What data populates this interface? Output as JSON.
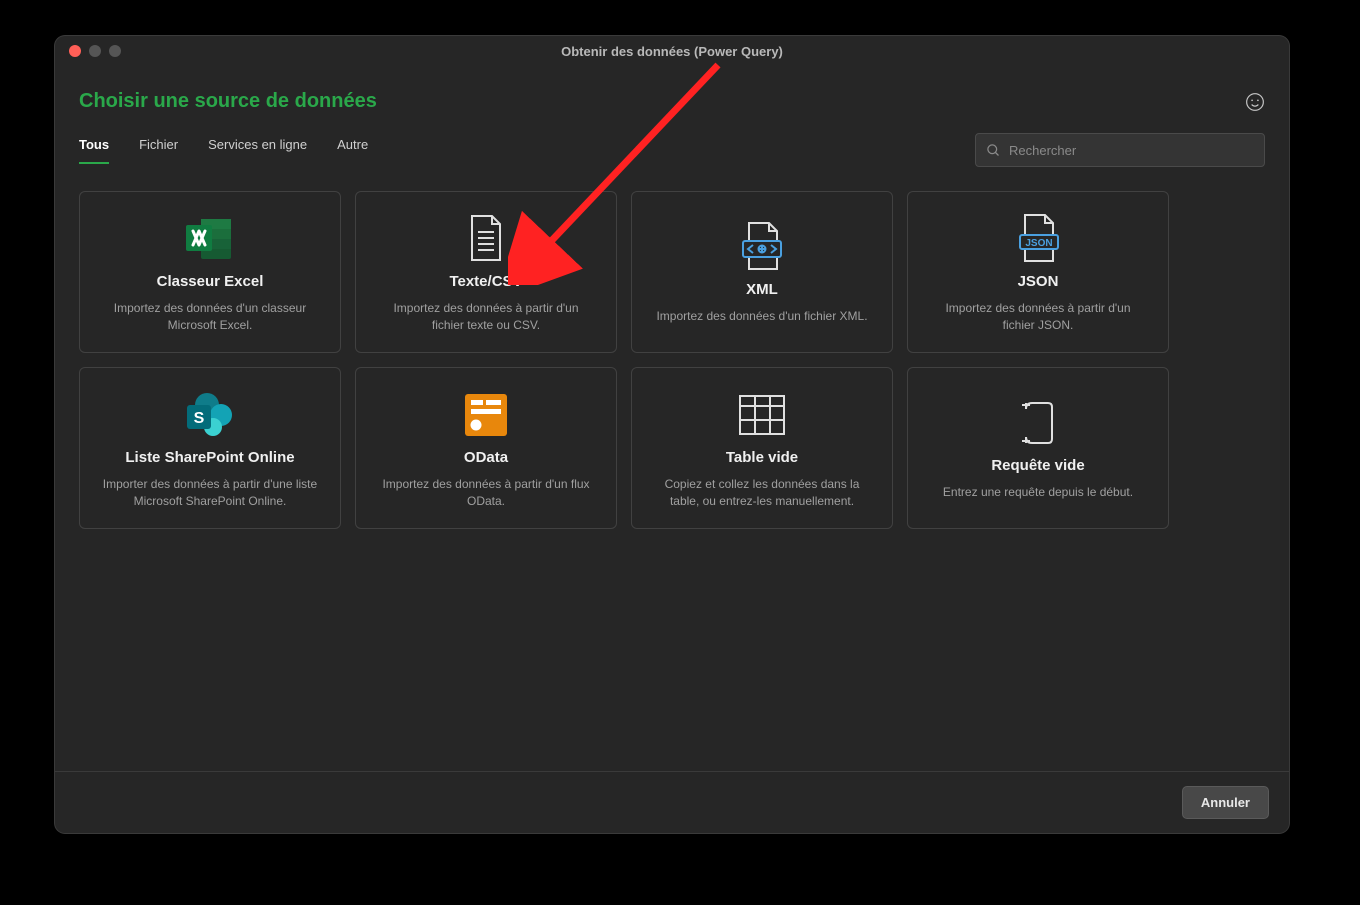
{
  "window": {
    "title": "Obtenir des données (Power Query)"
  },
  "heading": "Choisir une source de données",
  "tabs": [
    "Tous",
    "Fichier",
    "Services en ligne",
    "Autre"
  ],
  "active_tab_index": 0,
  "search": {
    "placeholder": "Rechercher"
  },
  "cards": [
    {
      "title": "Classeur Excel",
      "desc": "Importez des données d'un classeur Microsoft Excel."
    },
    {
      "title": "Texte/CSV",
      "desc": "Importez des données à partir d'un fichier texte ou CSV."
    },
    {
      "title": "XML",
      "desc": "Importez des données d'un fichier XML."
    },
    {
      "title": "JSON",
      "desc": "Importez des données à partir d'un fichier JSON."
    },
    {
      "title": "Liste SharePoint Online",
      "desc": "Importer des données à partir d'une liste Microsoft SharePoint Online."
    },
    {
      "title": "OData",
      "desc": "Importez des données à partir d'un flux OData."
    },
    {
      "title": "Table vide",
      "desc": "Copiez et collez les données dans la table, ou entrez-les manuellement."
    },
    {
      "title": "Requête vide",
      "desc": "Entrez une requête depuis le début."
    }
  ],
  "footer": {
    "cancel": "Annuler"
  }
}
